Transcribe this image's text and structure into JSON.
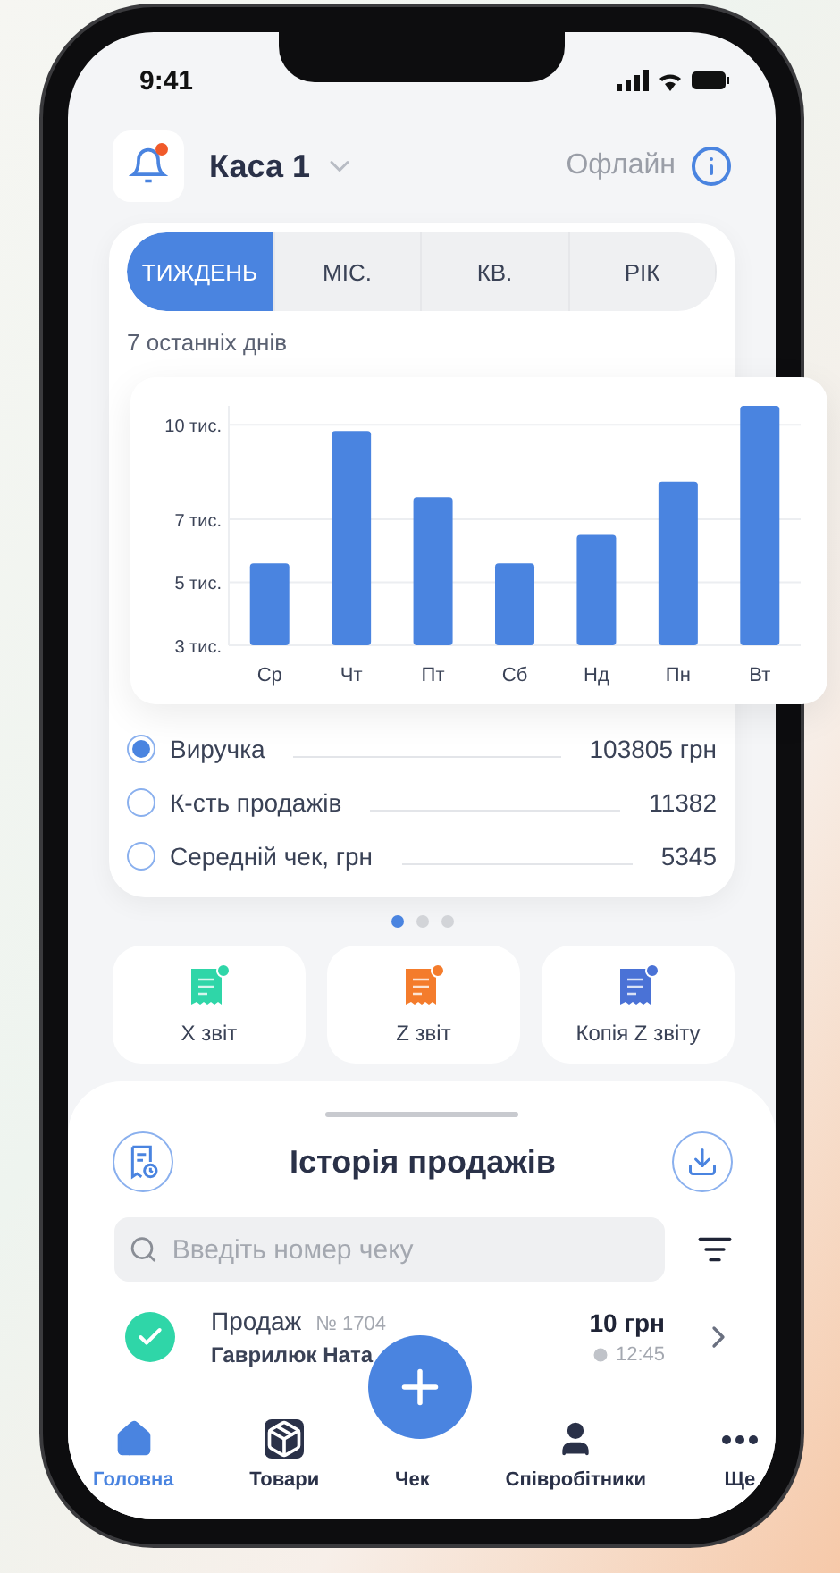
{
  "status_bar": {
    "time": "9:41"
  },
  "header": {
    "register": "Каса 1",
    "status": "Офлайн",
    "has_notification": true
  },
  "period_tabs": [
    {
      "label": "ТИЖДЕНЬ",
      "selected": true
    },
    {
      "label": "МІС.",
      "selected": false
    },
    {
      "label": "КВ.",
      "selected": false
    },
    {
      "label": "РІК",
      "selected": false
    }
  ],
  "period_caption": "7 останніх днів",
  "chart_data": {
    "type": "bar",
    "categories": [
      "Ср",
      "Чт",
      "Пт",
      "Сб",
      "Нд",
      "Пн",
      "Вт"
    ],
    "values": [
      5.6,
      9.8,
      7.7,
      5.6,
      6.5,
      8.2,
      10.6
    ],
    "ylim": [
      3,
      10.6
    ],
    "grid": true,
    "yticks": [
      {
        "value": 3,
        "label": "3 тис."
      },
      {
        "value": 5,
        "label": "5 тис."
      },
      {
        "value": 7,
        "label": "7 тис."
      },
      {
        "value": 10,
        "label": "10 тис."
      }
    ]
  },
  "metrics": [
    {
      "label": "Виручка",
      "value": "103805 грн",
      "selected": true
    },
    {
      "label": "К-сть продажів",
      "value": "11382",
      "selected": false
    },
    {
      "label": "Середній чек, грн",
      "value": "5345",
      "selected": false
    }
  ],
  "pager": [
    {
      "selected": true
    },
    {
      "selected": false
    },
    {
      "selected": false
    }
  ],
  "reports": [
    {
      "label": "X звіт",
      "color": "#2fd6a8"
    },
    {
      "label": "Z звіт",
      "color": "#f47c2c"
    },
    {
      "label": "Копія Z звіту",
      "color": "#4a72d6"
    }
  ],
  "history": {
    "title": "Історія продажів",
    "search": {
      "placeholder": "Введіть номер чеку"
    },
    "sales": [
      {
        "type": "Продаж",
        "number": "№ 1704",
        "cashier": "Гаврилюк Ната",
        "amount": "10 грн",
        "time": "12:45",
        "done": true
      }
    ]
  },
  "nav": [
    {
      "label": "Головна",
      "kind": "home",
      "selected": true
    },
    {
      "label": "Товари",
      "kind": "box",
      "selected": false
    },
    {
      "label": "Чек",
      "kind": "fab",
      "selected": false
    },
    {
      "label": "Співробітники",
      "kind": "person",
      "selected": false
    },
    {
      "label": "Ще",
      "kind": "more",
      "selected": false
    }
  ]
}
